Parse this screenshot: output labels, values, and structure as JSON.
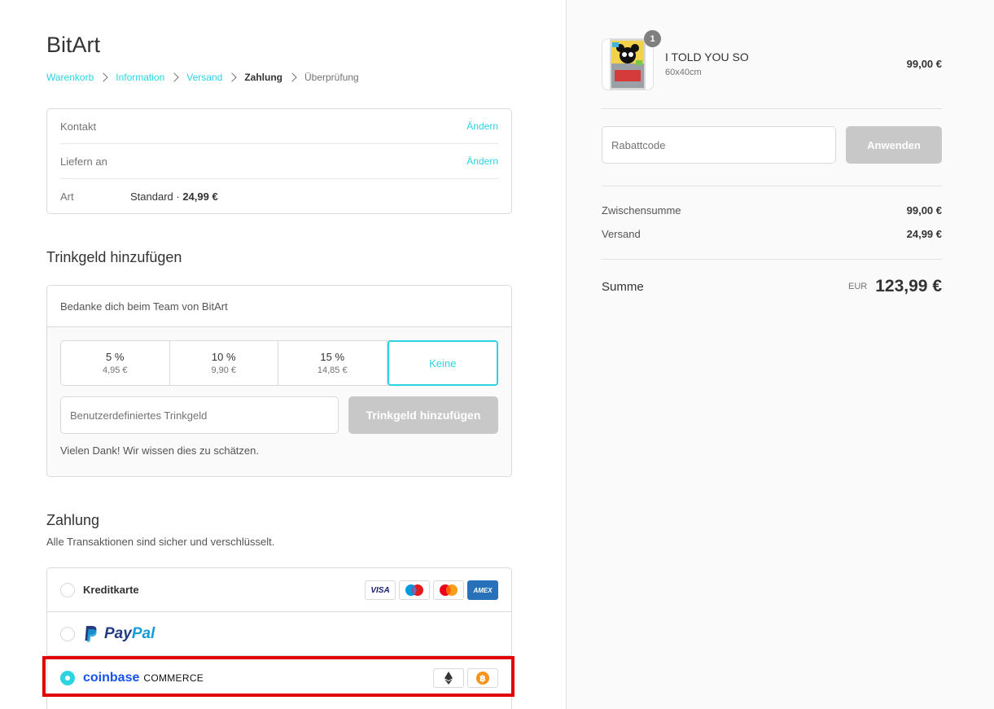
{
  "shop": {
    "title": "BitArt"
  },
  "breadcrumb": {
    "items": [
      {
        "label": "Warenkorb"
      },
      {
        "label": "Information"
      },
      {
        "label": "Versand"
      },
      {
        "label": "Zahlung"
      },
      {
        "label": "Überprüfung"
      }
    ]
  },
  "review": {
    "contact_label": "Kontakt",
    "ship_to_label": "Liefern an",
    "method_label": "Art",
    "method_value": "Standard · ",
    "method_price": "24,99 €",
    "change_link": "Ändern"
  },
  "tip": {
    "title": "Trinkgeld hinzufügen",
    "header": "Bedanke dich beim Team von BitArt",
    "options": [
      {
        "pct": "5 %",
        "amt": "4,95 €"
      },
      {
        "pct": "10 %",
        "amt": "9,90 €"
      },
      {
        "pct": "15 %",
        "amt": "14,85 €"
      },
      {
        "pct": "Keine",
        "amt": ""
      }
    ],
    "custom_placeholder": "Benutzerdefiniertes Trinkgeld",
    "add_button": "Trinkgeld hinzufügen",
    "thanks": "Vielen Dank! Wir wissen dies zu schätzen."
  },
  "payment": {
    "title": "Zahlung",
    "subtitle": "Alle Transaktionen sind sicher und verschlüsselt.",
    "credit_card_label": "Kreditkarte",
    "card_icons": [
      "visa-icon",
      "maestro-icon",
      "mastercard-icon",
      "amex-icon"
    ],
    "paypal_text_1": "Pay",
    "paypal_text_2": "Pal",
    "coinbase_text": "coinbase",
    "commerce_text": "COMMERCE",
    "crypto_icons": [
      "ethereum-icon",
      "bitcoin-icon"
    ],
    "visa_text": "VISA",
    "amex_text": "AMEX"
  },
  "order": {
    "quantity": "1",
    "product_name": "I TOLD YOU SO",
    "variant": "60x40cm",
    "price": "99,00 €",
    "discount_placeholder": "Rabattcode",
    "apply_button": "Anwenden",
    "subtotal_label": "Zwischensumme",
    "subtotal_value": "99,00 €",
    "shipping_label": "Versand",
    "shipping_value": "24,99 €",
    "total_label": "Summe",
    "currency": "EUR",
    "total_value": "123,99 €"
  },
  "colors": {
    "accent": "#2bd4e0",
    "highlight": "#e00000",
    "disabled_button": "#c8c8c8"
  }
}
